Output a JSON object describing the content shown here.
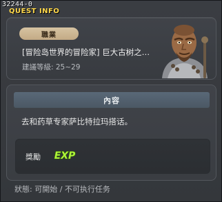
{
  "window": {
    "id_label": "32244-0",
    "title": "QUEST INFO"
  },
  "quest": {
    "job_badge": "職業",
    "name": "[冒险岛世界的冒险家] 巨大古树之…",
    "level_label": "建議等級: 25~29",
    "npc_icon": "npc-portrait-icon"
  },
  "content": {
    "header": "內容",
    "text": "去和药草专家萨比特拉玛搭话。"
  },
  "reward": {
    "label": "獎勵",
    "exp_icon": "EXP"
  },
  "status": {
    "text": "狀態: 可開始 / 不可执行任务"
  },
  "colors": {
    "title": "#ffd84a",
    "badge": "#cdb793",
    "content_header": "#546270",
    "exp": "#aef23a"
  }
}
